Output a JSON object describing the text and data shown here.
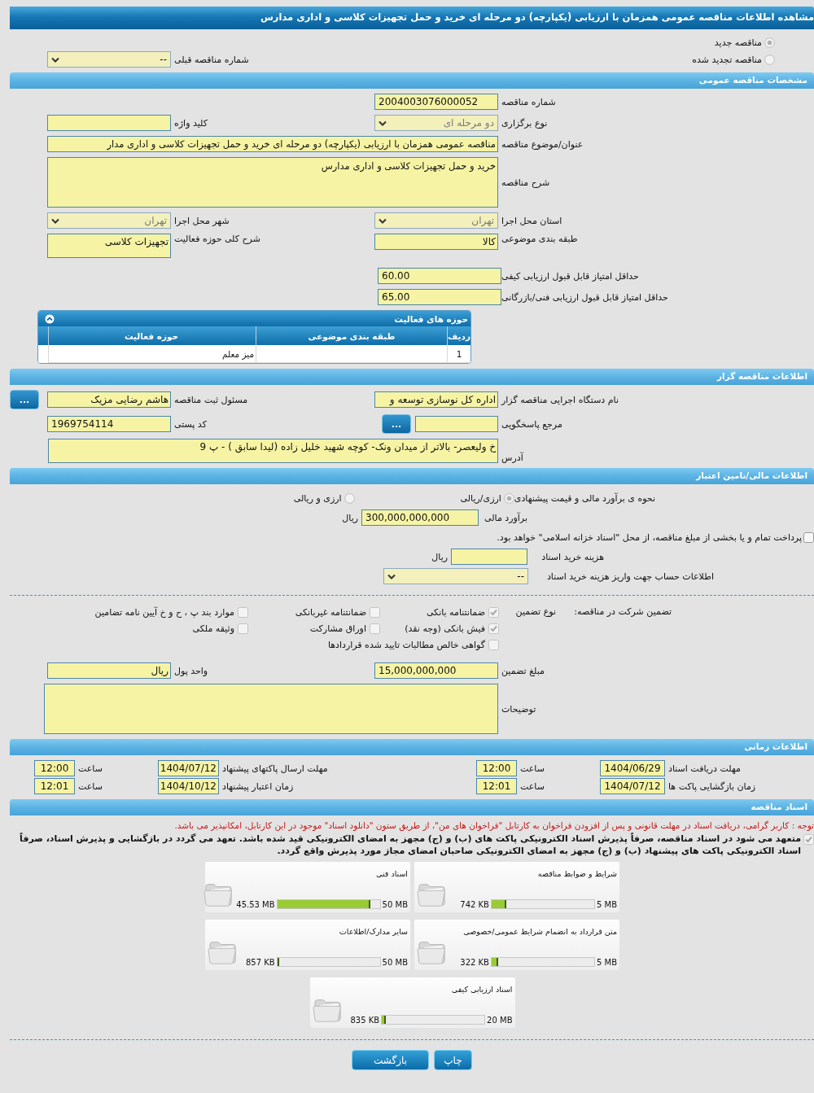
{
  "title": "مشاهده اطلاعات مناقصه عمومی همزمان با ارزیابی (یکپارچه) دو مرحله ای خرید و حمل تجهیزات کلاسی و اداری مدارس",
  "tender_status": [
    {
      "label": "مناقصه جدید",
      "selected": true
    },
    {
      "label": "مناقصه تجدید شده",
      "selected": false
    }
  ],
  "previous_tender": {
    "label": "شماره مناقصه قبلی",
    "value": "--"
  },
  "general": {
    "heading": "مشخصات مناقصه عمومی",
    "tender_number": {
      "label": "شماره مناقصه",
      "value": "2004003076000052"
    },
    "holding_type": {
      "label": "نوع برگزاری",
      "value": "دو مرحله ای"
    },
    "keyword": {
      "label": "کلید واژه"
    },
    "subject": {
      "label": "عنوان/موضوع مناقصه",
      "value": "مناقصه عمومی همزمان با ارزیابی (یکپارچه) دو مرحله ای خرید و حمل تجهیزات کلاسی و اداری مدار"
    },
    "description": {
      "label": "شرح مناقصه",
      "value": "خرید و حمل تجهیزات کلاسی و اداری مدارس"
    },
    "province": {
      "label": "استان محل اجرا",
      "value": "تهران"
    },
    "city": {
      "label": "شهر محل اجرا",
      "value": "تهران"
    },
    "category": {
      "label": "طبقه بندی موضوعی",
      "value": "کالا"
    },
    "activity_scope": {
      "label": "شرح کلی حوزه فعالیت",
      "value": "تجهیزات کلاسی"
    },
    "min_quality_score": {
      "label": "حداقل امتیاز قابل قبول ارزیابی کیفی",
      "value": "60.00"
    },
    "min_technical_score": {
      "label": "حداقل امتیاز قابل قبول ارزیابی فنی/بازرگانی",
      "value": "65.00"
    },
    "activity_table": {
      "title": "حوزه های فعالیت",
      "expanded": true,
      "columns": [
        "ردیف",
        "طبقه بندی موضوعی",
        "حوزه فعالیت"
      ],
      "rows": [
        {
          "row_number": "1",
          "activity": "میز معلم"
        }
      ]
    }
  },
  "organizer": {
    "heading": "اطلاعات مناقصه گزار",
    "agency": {
      "label": "نام دستگاه اجرایی مناقصه گزار",
      "value": "اداره کل نوسازی  توسعه و"
    },
    "registrar": {
      "label": "مسئول ثبت مناقصه",
      "value": "هاشم رضایی مزیک",
      "button": "..."
    },
    "reference": {
      "label": "مرجع پاسخگویی",
      "button": "..."
    },
    "postal_code": {
      "label": "کد پستی",
      "value": "1969754114"
    },
    "address": {
      "label": "آدرس",
      "value": "خ ولیعصر- بالاتر از میدان ونک- کوچه شهید خلیل زاده (لیدا سابق ) - پ 9"
    }
  },
  "finance": {
    "heading": "اطلاعات مالی/تامین اعتبار",
    "pricing_method": {
      "label": "نحوه ی برآورد مالی و قیمت پیشنهادی",
      "options": [
        {
          "label": "ارزی/ریالی",
          "selected": true
        },
        {
          "label": "ارزی و ریالی",
          "selected": false
        }
      ]
    },
    "estimate": {
      "label": "برآورد مالی",
      "value": "300,000,000,000",
      "unit": "ریال"
    },
    "treasury_payment": {
      "text": "پرداخت تمام و یا بخشی از مبلغ مناقصه، از محل \"اسناد خزانه اسلامی\" خواهد بود.",
      "checked": false
    },
    "document_fee": {
      "label": "هزینه خرید اسناد",
      "unit": "ریال"
    },
    "fee_account": {
      "label": "اطلاعات حساب جهت واریز هزینه خرید اسناد",
      "value": "--"
    }
  },
  "guarantee": {
    "label": "تضمین شرکت در مناقصه:",
    "type_label": "نوع تضمین",
    "types": [
      {
        "label": "ضمانتنامه بانکی",
        "checked": true
      },
      {
        "label": "ضمانتنامه غیربانکی",
        "checked": false
      },
      {
        "label": "موارد بند پ ، ح و خ آیین نامه تضامین",
        "checked": false
      },
      {
        "label": "فیش بانکی (وجه نقد)",
        "checked": true
      },
      {
        "label": "اوراق مشارکت",
        "checked": false
      },
      {
        "label": "وثیقه ملکی",
        "checked": false
      },
      {
        "label": "گواهی خالص مطالبات تایید شده قراردادها",
        "checked": false
      }
    ],
    "amount": {
      "label": "مبلغ تضمین",
      "value": "15,000,000,000"
    },
    "currency": {
      "label": "واحد پول",
      "value": "ریال"
    },
    "notes": {
      "label": "توضیحات"
    }
  },
  "timing": {
    "heading": "اطلاعات زمانی",
    "rows": [
      {
        "label": "مهلت دریافت اسناد",
        "date": "1404/06/29",
        "time_label": "ساعت",
        "time": "12:00"
      },
      {
        "label": "مهلت ارسال پاکتهای پیشنهاد",
        "date": "1404/07/12",
        "time_label": "ساعت",
        "time": "12:00"
      },
      {
        "label": "زمان بازگشایی پاکت ها",
        "date": "1404/07/12",
        "time_label": "ساعت",
        "time": "12:01"
      },
      {
        "label": "زمان اعتبار پیشنهاد",
        "date": "1404/10/12",
        "time_label": "ساعت",
        "time": "12:01"
      }
    ]
  },
  "documents": {
    "heading": "اسناد مناقصه",
    "notice": "توجه : کاربر گرامی، دریافت اسناد در مهلت قانونی و پس از افزودن فراخوان به کارتابل \"فراخوان های من\"، از طریق ستون \"دانلود اسناد\" موجود در این کارتابل، امکانپذیر می باشد.",
    "commitment": {
      "checked": true,
      "text": "متعهد می شود در اسناد مناقصه، صرفاً پذیرش اسناد الکترونیکی پاکت های (ب) و (ج) مجهز به امضای الکترونیکی قید شده باشد. تعهد می گردد در بازگشایی و پذیرش اسناد، صرفاً اسناد الکترونیکی پاکت های پیشنهاد (ب) و (ج) مجهز به امضای الکترونیکی صاحبان امضای مجاز مورد پذیرش واقع گردد."
    },
    "files": [
      {
        "name": "شرایط و ضوابط مناقصه",
        "used": "742 KB",
        "limit": "5 MB",
        "level": 0.145
      },
      {
        "name": "اسناد فنی",
        "used": "45.53 MB",
        "limit": "50 MB",
        "level": 0.91
      },
      {
        "name": "متن قرارداد به انضمام شرایط عمومی/خصوصی",
        "used": "322 KB",
        "limit": "5 MB",
        "level": 0.063
      },
      {
        "name": "سایر مدارک/اطلاعات",
        "used": "857 KB",
        "limit": "50 MB",
        "level": 0.017
      },
      {
        "name": "اسناد ارزیابی کیفی",
        "used": "835 KB",
        "limit": "20 MB",
        "level": 0.041
      }
    ]
  },
  "buttons": [
    {
      "label": "چاپ"
    },
    {
      "label": "بازگشت"
    }
  ]
}
